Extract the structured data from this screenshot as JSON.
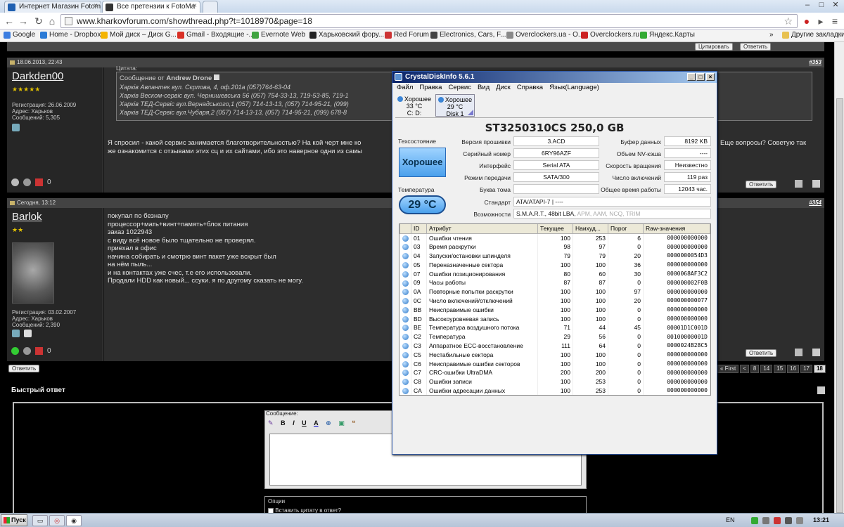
{
  "browser": {
    "tabs": [
      {
        "title": "Интернет Магазин Fotom"
      },
      {
        "title": "Все претензии к FotoMa"
      }
    ],
    "url": "www.kharkovforum.com/showthread.php?t=1018970&page=18",
    "bookmarks": [
      "Google",
      "Home - Dropbox",
      "Мой диск – Диск G...",
      "Gmail - Входящие -...",
      "Evernote Web",
      "Харьковский фору...",
      "Red Forum",
      "Electronics, Cars, F...",
      "Overclockers.ua - О...",
      "Overclockers.ru",
      "Яндекс.Карты"
    ],
    "other_bookmarks": "Другие закладки",
    "bookmark_more": "»"
  },
  "forum": {
    "top_buttons": [
      "Цитировать",
      "Ответить"
    ],
    "posts": [
      {
        "date": "18.06.2013, 22:43",
        "number": "#353",
        "username": "Darkden00",
        "stars": "★★★★★",
        "info": [
          "Регистрация: 26.06.2009",
          "Адрес: Харьков",
          "Сообщений: 5,305"
        ],
        "quote_label": "Цитата:",
        "quote_from_prefix": "Сообщение от",
        "quote_author": "Andrew Drone",
        "quote_lines": [
          "Харків Авлантек вул. Сєрпова, 4, оф.201а (057)764-63-04",
          "Харків Веском-сервіс вул. Чернишевська 56 (057) 754-33-13, 719-53-85, 719-1",
          "Харків ТЕД-Сервіс вул.Вернадського,1 (057) 714-13-13, (057) 714-95-21, (099)",
          "Харків ТЕД-Сервіс вул.Чубаря,2 (057) 714-13-13, (057) 714-95-21, (099) 678-8"
        ],
        "text_left": "Я спросил - какой сервис занимается благотворительностью? На кой черт мне ко\nже ознакомится с отзывами этих сц и их сайтами, ибо это наверное одни из самы",
        "text_right": "Еще вопросы? Советую так",
        "reply": "Ответить",
        "counter": "0"
      },
      {
        "date": "Сегодня, 13:12",
        "number": "#354",
        "username": "Barlok",
        "stars": "★★",
        "info": [
          "Регистрация: 03.02.2007",
          "Адрес: Харьков",
          "Сообщений: 2,390"
        ],
        "text": "покупал по безналу\nпроцессор+мать+винт+память+блок питания\nзаказ 1022943\nс виду всё новое было тщательно не проверял.\nприехал в офис\nначина собирать и смотрю винт пакет уже вскрыт был\nна нём пыль...\nи на контактах уже счес, т.е его использовали.\nПродали HDD как новый... ссуки. я по другому сказать не могу.",
        "reply": "Ответить",
        "counter": "0"
      }
    ],
    "bottom_reply": "Ответить",
    "pagination": [
      "« First",
      "<",
      "8",
      "14",
      "15",
      "16",
      "17",
      "18"
    ],
    "pagination_current": "18",
    "quick_reply_title": "Быстрый ответ",
    "message_label": "Сообщение:",
    "editor_tools": [
      "B",
      "I",
      "U",
      "A"
    ],
    "options_label": "Опции",
    "quote_checkbox": "Вставить цитату в ответ?"
  },
  "cdi": {
    "title": "CrystalDiskInfo 5.6.1",
    "menu": [
      "Файл",
      "Правка",
      "Сервис",
      "Вид",
      "Диск",
      "Справка",
      "Язык(Language)"
    ],
    "disks": [
      {
        "status": "Хорошее",
        "temp": "33 °C",
        "drive": "C: D:"
      },
      {
        "status": "Хорошее",
        "temp": "29 °C",
        "drive": "Disk 1"
      }
    ],
    "model": "ST3250310CS  250,0 GB",
    "health_label": "Техсостояние",
    "health": "Хорошее",
    "temp_label": "Температура",
    "temp": "29 °C",
    "fields": {
      "firmware_label": "Версия прошивки",
      "firmware": "3.ACD",
      "serial_label": "Серийный номер",
      "serial": "6RY96AZF",
      "interface_label": "Интерфейс",
      "interface": "Serial ATA",
      "transfer_label": "Режим передачи",
      "transfer": "SATA/300",
      "letter_label": "Буква тома",
      "letter": "",
      "standard_label": "Стандарт",
      "standard": "ATA/ATAPI-7 | ----",
      "features_label": "Возможности",
      "features_active": "S.M.A.R.T., 48bit LBA,",
      "features_inactive": "APM, AAM, NCQ, TRIM",
      "buffer_label": "Буфер данных",
      "buffer": "8192 KB",
      "nvcache_label": "Объем NV-кэша",
      "nvcache": "----",
      "rpm_label": "Скорость вращения",
      "rpm": "Неизвестно",
      "power_count_label": "Число включений",
      "power_count": "119 раз",
      "power_hours_label": "Общее время работы",
      "power_hours": "12043 час."
    },
    "smart_headers": [
      "ID",
      "Атрибут",
      "Текущее",
      "Наихуд...",
      "Порог",
      "Raw-значения"
    ],
    "smart_rows": [
      {
        "id": "01",
        "name": "Ошибки чтения",
        "cur": "100",
        "worst": "253",
        "thr": "6",
        "raw": "000000000000"
      },
      {
        "id": "03",
        "name": "Время раскрутки",
        "cur": "98",
        "worst": "97",
        "thr": "0",
        "raw": "000000000000"
      },
      {
        "id": "04",
        "name": "Запуски/остановки шпинделя",
        "cur": "79",
        "worst": "79",
        "thr": "20",
        "raw": "0000000054D3"
      },
      {
        "id": "05",
        "name": "Переназначенные сектора",
        "cur": "100",
        "worst": "100",
        "thr": "36",
        "raw": "000000000000"
      },
      {
        "id": "07",
        "name": "Ошибки позиционирования",
        "cur": "80",
        "worst": "60",
        "thr": "30",
        "raw": "0000068AF3C2"
      },
      {
        "id": "09",
        "name": "Часы работы",
        "cur": "87",
        "worst": "87",
        "thr": "0",
        "raw": "000000002F0B"
      },
      {
        "id": "0A",
        "name": "Повторные попытки раскрутки",
        "cur": "100",
        "worst": "100",
        "thr": "97",
        "raw": "000000000000"
      },
      {
        "id": "0C",
        "name": "Число включений/отключений",
        "cur": "100",
        "worst": "100",
        "thr": "20",
        "raw": "000000000077"
      },
      {
        "id": "BB",
        "name": "Неисправимые ошибки",
        "cur": "100",
        "worst": "100",
        "thr": "0",
        "raw": "000000000000"
      },
      {
        "id": "BD",
        "name": "Высокоуровневая запись",
        "cur": "100",
        "worst": "100",
        "thr": "0",
        "raw": "000000000000"
      },
      {
        "id": "BE",
        "name": "Температура воздушного потока",
        "cur": "71",
        "worst": "44",
        "thr": "45",
        "raw": "00001D1C001D"
      },
      {
        "id": "C2",
        "name": "Температура",
        "cur": "29",
        "worst": "56",
        "thr": "0",
        "raw": "00100000001D"
      },
      {
        "id": "C3",
        "name": "Аппаратное ECC-восстановление",
        "cur": "111",
        "worst": "64",
        "thr": "0",
        "raw": "0000024B28C5"
      },
      {
        "id": "C5",
        "name": "Нестабильные сектора",
        "cur": "100",
        "worst": "100",
        "thr": "0",
        "raw": "000000000000"
      },
      {
        "id": "C6",
        "name": "Неисправимые ошибки секторов",
        "cur": "100",
        "worst": "100",
        "thr": "0",
        "raw": "000000000000"
      },
      {
        "id": "C7",
        "name": "CRC-ошибки UltraDMA",
        "cur": "200",
        "worst": "200",
        "thr": "0",
        "raw": "000000000000"
      },
      {
        "id": "C8",
        "name": "Ошибки записи",
        "cur": "100",
        "worst": "253",
        "thr": "0",
        "raw": "000000000000"
      },
      {
        "id": "CA",
        "name": "Ошибки адресации данных",
        "cur": "100",
        "worst": "253",
        "thr": "0",
        "raw": "000000000000"
      }
    ]
  },
  "taskbar": {
    "start": "Пуск",
    "lang": "EN",
    "time": "13:21"
  },
  "colors": {
    "health_blue": "#4aa0ec",
    "forum_bg": "#000000",
    "titlebar": "#0a246a"
  }
}
